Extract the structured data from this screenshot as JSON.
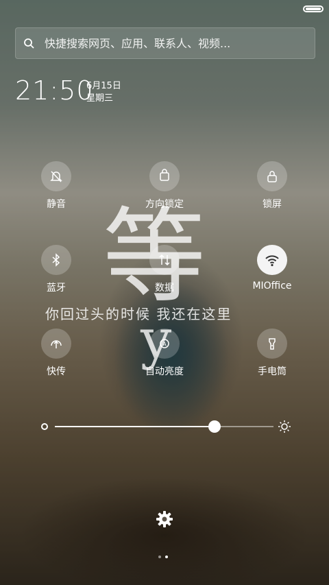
{
  "search": {
    "placeholder": "快捷搜索网页、应用、联系人、视频..."
  },
  "clock": {
    "time": "21:50",
    "date": "6月15日",
    "weekday": "星期三"
  },
  "overlay": {
    "big_char": "等",
    "small_char": "y",
    "lyric": "你回过头的时候 我还在这里"
  },
  "toggles": {
    "mute": {
      "label": "静音",
      "icon": "bell-off-icon",
      "active": false
    },
    "rotation_lock": {
      "label": "方向锁定",
      "icon": "rotation-lock-icon",
      "active": false
    },
    "lock_screen": {
      "label": "锁屏",
      "icon": "lock-icon",
      "active": false
    },
    "bluetooth": {
      "label": "蓝牙",
      "icon": "bluetooth-icon",
      "active": false
    },
    "data": {
      "label": "数据",
      "icon": "mobile-data-icon",
      "active": false
    },
    "wifi": {
      "label": "MIOffice",
      "icon": "wifi-icon",
      "active": true
    },
    "quick_share": {
      "label": "快传",
      "icon": "quick-share-icon",
      "active": false
    },
    "auto_brightness": {
      "label": "自动亮度",
      "icon": "auto-brightness-icon",
      "active": false
    },
    "flashlight": {
      "label": "手电筒",
      "icon": "flashlight-icon",
      "active": false
    }
  },
  "brightness": {
    "level": 0.73
  },
  "pager": {
    "pages": 2,
    "current": 2
  },
  "colors": {
    "active_toggle_bg": "#f4f4f4",
    "inactive_toggle_bg": "rgba(255,255,255,0.22)"
  }
}
